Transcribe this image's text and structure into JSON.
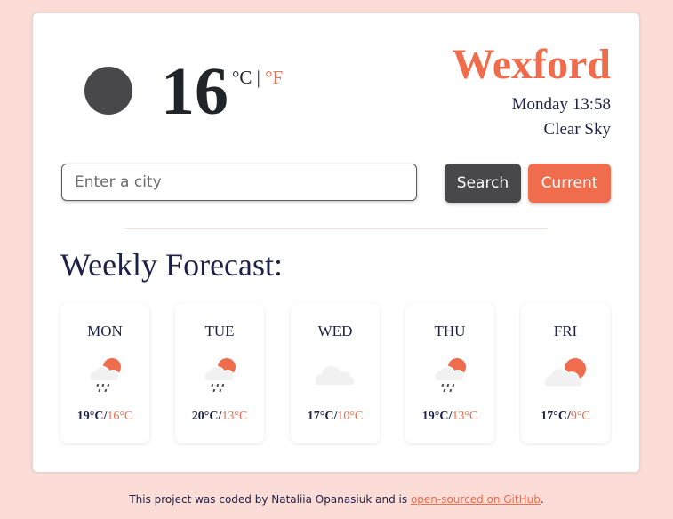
{
  "current": {
    "temperature": "16",
    "unit_celsius": "°C",
    "unit_separator": "|",
    "unit_fahrenheit": "°F",
    "icon": "clear-night-icon",
    "city": "Wexford",
    "datetime": "Monday 13:58",
    "description": "Clear Sky"
  },
  "search": {
    "placeholder": "Enter a city",
    "value": "",
    "search_label": "Search",
    "current_label": "Current"
  },
  "forecast": {
    "title": "Weekly Forecast:",
    "days": [
      {
        "day": "MON",
        "icon": "rain-sun-cloud-icon",
        "max": "19°C",
        "min": "16°C"
      },
      {
        "day": "TUE",
        "icon": "rain-sun-cloud-icon",
        "max": "20°C",
        "min": "13°C"
      },
      {
        "day": "WED",
        "icon": "cloud-icon",
        "max": "17°C",
        "min": "10°C"
      },
      {
        "day": "THU",
        "icon": "rain-sun-cloud-icon",
        "max": "19°C",
        "min": "13°C"
      },
      {
        "day": "FRI",
        "icon": "partly-cloudy-icon",
        "max": "17°C",
        "min": "9°C"
      }
    ]
  },
  "footer": {
    "text": "This project was coded by Nataliia Opanasiuk and is ",
    "link_text": "open-sourced on GitHub",
    "suffix": "."
  },
  "colors": {
    "accent": "#ef6c4c",
    "dark": "#48484a",
    "background": "#fcdcd6",
    "text": "#1e2147"
  }
}
